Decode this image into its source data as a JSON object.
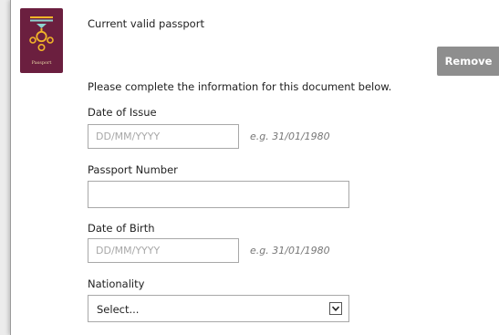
{
  "document": {
    "title": "Current valid passport",
    "passport_label": "Passport",
    "remove_label": "Remove",
    "instructions": "Please complete the information for this document below."
  },
  "form": {
    "date_of_issue": {
      "label": "Date of Issue",
      "placeholder": "DD/MM/YYYY",
      "value": "",
      "hint": "e.g. 31/01/1980"
    },
    "passport_number": {
      "label": "Passport Number",
      "placeholder": "",
      "value": ""
    },
    "date_of_birth": {
      "label": "Date of Birth",
      "placeholder": "DD/MM/YYYY",
      "value": "",
      "hint": "e.g. 31/01/1980"
    },
    "nationality": {
      "label": "Nationality",
      "selected": "Select..."
    }
  },
  "colors": {
    "passport_cover": "#6b1f3f",
    "passport_emblem": "#f0b429",
    "remove_button": "#8e8e8e"
  },
  "icons": {
    "passport_emblem": "passport-emblem-icon",
    "dropdown": "chevron-down-icon"
  }
}
